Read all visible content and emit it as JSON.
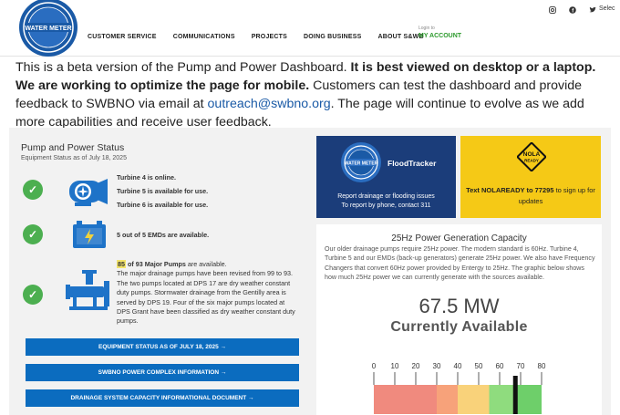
{
  "header": {
    "nav": [
      "CUSTOMER SERVICE",
      "COMMUNICATIONS",
      "PROJECTS",
      "DOING BUSINESS",
      "ABOUT S&WB"
    ],
    "login_small": "Login to",
    "my_account": "MY ACCOUNT",
    "social_icons": [
      "instagram-icon",
      "facebook-icon",
      "twitter-icon"
    ],
    "select_label": "Selec",
    "logo_text": "WATER METER"
  },
  "notice": {
    "part1": "This is a beta version of the Pump and Power Dashboard. ",
    "bold": "It is best viewed on desktop or a laptop. We are working to optimize the page for mobile.",
    "part2": " Customers can test the dashboard and provide feedback to SWBNO via email at ",
    "email": "outreach@swbno.org",
    "part3": ". The page will continue to evolve as we add more capabilities and receive user feedback."
  },
  "status": {
    "title": "Pump and Power Status",
    "subtitle": "Equipment Status as of July 18, 2025",
    "turbine_line1": "Turbine 4 is online.",
    "turbine_line2": "Turbine 5 is available for use.",
    "turbine_line3": "Turbine 6 is available for use.",
    "emd_line": "5 out of 5 EMDs are available.",
    "major_count": "85",
    "major_rest": " of 93 Major Pumps",
    "major_suffix": " are available.",
    "major_body": "The major drainage pumps have been revised from 99 to 93. The two pumps located at DPS 17 are dry weather constant duty pumps. Stormwater drainage from the Gentilly area is served by DPS 19. Four of the six major pumps located at DPS Grant have been classified as dry weather constant duty pumps.",
    "buttons": [
      "EQUIPMENT STATUS AS OF JULY 18, 2025 →",
      "SWBNO POWER COMPLEX INFORMATION →",
      "DRAINAGE SYSTEM CAPACITY INFORMATIONAL DOCUMENT →"
    ]
  },
  "flood": {
    "title": "FloodTracker",
    "line1": "Report drainage or flooding issues",
    "line2": "To report by phone, contact 311"
  },
  "nola": {
    "sign_line1": "NOLA",
    "sign_line2": "READY",
    "text_bold": "Text NOLAREADY to 77295",
    "text_rest": " to sign up for updates"
  },
  "hz": {
    "title": "25Hz Power Generation Capacity",
    "body": "Our older drainage pumps require 25Hz power. The modern standard is 60Hz. Turbine 4, Turbine 5 and our EMDs (back-up generators) generate 25Hz power. We also have Frequency Changers that convert 60Hz power provided by Entergy to 25Hz. The graphic below shows how much 25Hz power we can currently generate with the sources available.",
    "value": "67.5 MW",
    "label": "Currently Available"
  },
  "gauge": {
    "ticks": [
      "0",
      "10",
      "20",
      "30",
      "40",
      "50",
      "60",
      "70",
      "80"
    ],
    "min": 0,
    "max": 80,
    "value": 67.5,
    "bands": [
      {
        "from": 0,
        "to": 30,
        "color": "#f08a7e"
      },
      {
        "from": 30,
        "to": 40,
        "color": "#f7a27a"
      },
      {
        "from": 40,
        "to": 55,
        "color": "#f9d27a"
      },
      {
        "from": 55,
        "to": 68,
        "color": "#8fdc7e"
      },
      {
        "from": 68,
        "to": 80,
        "color": "#6ecf6a"
      }
    ]
  },
  "colors": {
    "accent_blue": "#0b6cbf",
    "flood_navy": "#1b3d7a",
    "nola_yellow": "#f5c916",
    "check_green": "#4caf50",
    "account_green": "#2c9a2c"
  }
}
